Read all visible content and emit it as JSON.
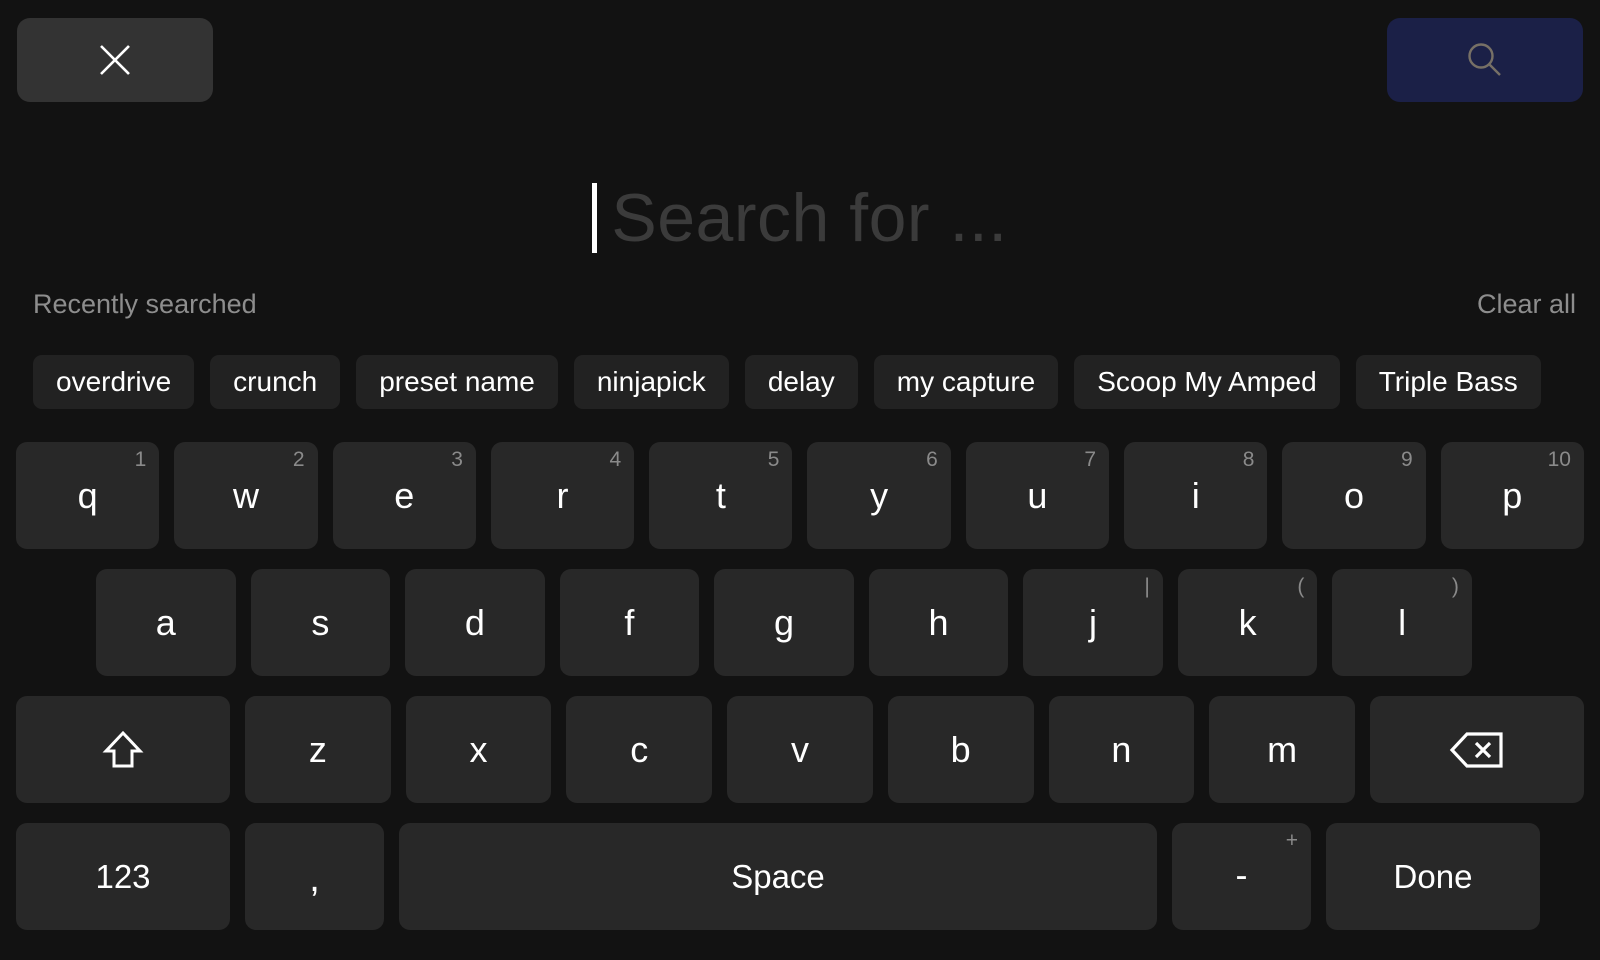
{
  "topbar": {
    "close_button": {
      "icon": "close-icon",
      "label": ""
    },
    "search_button": {
      "icon": "search-icon",
      "label": "",
      "color": "#1b2047"
    }
  },
  "search": {
    "value": "",
    "placeholder": "Search for ...",
    "caret_visible": true
  },
  "recent": {
    "title": "Recently searched",
    "clear_all": "Clear all",
    "items": [
      "overdrive",
      "crunch",
      "preset name",
      "ninjapick",
      "delay",
      "my capture",
      "Scoop My Amped",
      "Triple Bass"
    ]
  },
  "keyboard": {
    "row1": [
      {
        "key": "q",
        "sup": "1"
      },
      {
        "key": "w",
        "sup": "2"
      },
      {
        "key": "e",
        "sup": "3"
      },
      {
        "key": "r",
        "sup": "4"
      },
      {
        "key": "t",
        "sup": "5"
      },
      {
        "key": "y",
        "sup": "6"
      },
      {
        "key": "u",
        "sup": "7"
      },
      {
        "key": "i",
        "sup": "8"
      },
      {
        "key": "o",
        "sup": "9"
      },
      {
        "key": "p",
        "sup": "10"
      }
    ],
    "row2": [
      {
        "key": "a",
        "sup": ""
      },
      {
        "key": "s",
        "sup": ""
      },
      {
        "key": "d",
        "sup": ""
      },
      {
        "key": "f",
        "sup": ""
      },
      {
        "key": "g",
        "sup": ""
      },
      {
        "key": "h",
        "sup": ""
      },
      {
        "key": "j",
        "sup": "|"
      },
      {
        "key": "k",
        "sup": "("
      },
      {
        "key": "l",
        "sup": ")"
      }
    ],
    "row3": [
      {
        "key": "shift",
        "icon": "shift-up-arrow-icon"
      },
      {
        "key": "z",
        "sup": ""
      },
      {
        "key": "x",
        "sup": ""
      },
      {
        "key": "c",
        "sup": ""
      },
      {
        "key": "v",
        "sup": ""
      },
      {
        "key": "b",
        "sup": ""
      },
      {
        "key": "n",
        "sup": ""
      },
      {
        "key": "m",
        "sup": ""
      },
      {
        "key": "backspace",
        "icon": "backspace-icon"
      }
    ],
    "row4": [
      {
        "key": "123",
        "sup": ""
      },
      {
        "key": ",",
        "sup": ""
      },
      {
        "key": "Space",
        "sup": ""
      },
      {
        "key": "-",
        "sup": "+"
      },
      {
        "key": "Done",
        "sup": ""
      }
    ]
  },
  "colors": {
    "background": "#121212",
    "key": "#282828",
    "chip": "#222222",
    "close_button": "#333333",
    "search_button": "#1b2047",
    "muted_text": "#8d8d8d",
    "placeholder_text": "#3b3b3b"
  }
}
